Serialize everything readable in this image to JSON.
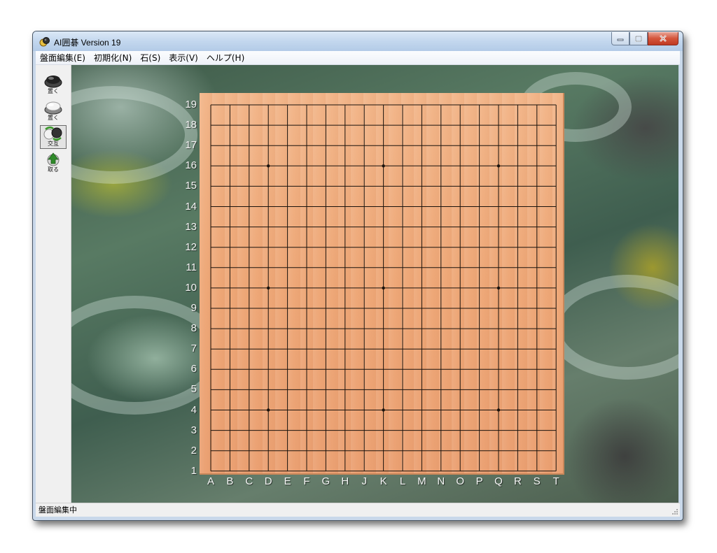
{
  "window": {
    "title": "AI囲碁 Version 19",
    "status": "盤面編集中"
  },
  "menu": [
    "盤面編集(E)",
    "初期化(N)",
    "石(S)",
    "表示(V)",
    "ヘルプ(H)"
  ],
  "tools": [
    {
      "label": "置く",
      "stone": "black",
      "selected": false
    },
    {
      "label": "置く",
      "stone": "white",
      "selected": false
    },
    {
      "label": "交互",
      "stone": "alternate",
      "selected": true
    },
    {
      "label": "取る",
      "stone": "remove",
      "selected": false
    }
  ],
  "board": {
    "size": 19,
    "columns": [
      "A",
      "B",
      "C",
      "D",
      "E",
      "F",
      "G",
      "H",
      "J",
      "K",
      "L",
      "M",
      "N",
      "O",
      "P",
      "Q",
      "R",
      "S",
      "T"
    ],
    "rows": [
      "19",
      "18",
      "17",
      "16",
      "15",
      "14",
      "13",
      "12",
      "11",
      "10",
      "9",
      "8",
      "7",
      "6",
      "5",
      "4",
      "3",
      "2",
      "1"
    ],
    "star_points": [
      [
        4,
        4
      ],
      [
        10,
        4
      ],
      [
        16,
        4
      ],
      [
        4,
        10
      ],
      [
        10,
        10
      ],
      [
        16,
        10
      ],
      [
        4,
        16
      ],
      [
        10,
        16
      ],
      [
        16,
        16
      ]
    ],
    "stones": [],
    "line_color": "#1a120c",
    "wood_color": "#eea878"
  }
}
